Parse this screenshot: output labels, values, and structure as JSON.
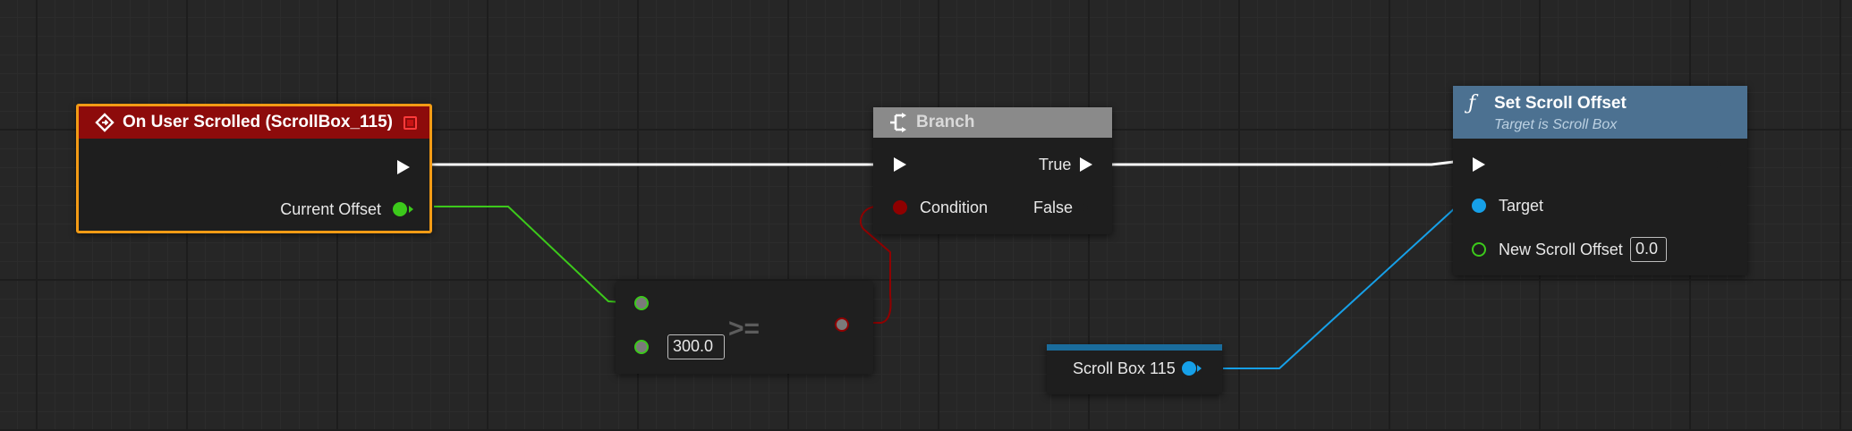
{
  "event_node": {
    "title": "On User Scrolled (ScrollBox_115)",
    "output_label": "Current Offset"
  },
  "branch_node": {
    "title": "Branch",
    "condition_label": "Condition",
    "true_label": "True",
    "false_label": "False"
  },
  "compare_node": {
    "operator": ">=",
    "input_value": "300.0"
  },
  "set_scroll_node": {
    "title": "Set Scroll Offset",
    "subtitle": "Target is Scroll Box",
    "target_label": "Target",
    "offset_label": "New Scroll Offset",
    "offset_value": "0.0"
  },
  "scroll_var_node": {
    "label": "Scroll Box 115"
  },
  "colors": {
    "exec_wire": "#ffffff",
    "float_pin": "#3cc91b",
    "bool_pin": "#8f0000",
    "object_pin": "#16a0e8",
    "event_header": "#8d0b0b",
    "event_outline": "#f39b15",
    "branch_header": "#8a8a8a",
    "function_header": "#4c7191",
    "variable_bar": "#1a6c9c"
  },
  "icons": [
    "event-icon",
    "delegate-icon",
    "branch-icon",
    "function-icon",
    "exec-pin-icon",
    "data-pin-icon"
  ]
}
